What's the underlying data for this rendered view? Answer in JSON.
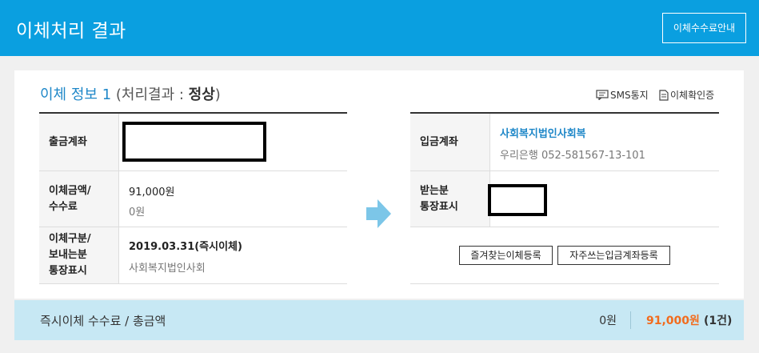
{
  "header": {
    "title": "이체처리 결과",
    "guide_button": "이체수수료안내"
  },
  "info": {
    "label": "이체 정보",
    "number": "1",
    "result_open": "(처리결과 : ",
    "result_status": "정상",
    "result_close": ")"
  },
  "tools": {
    "sms": "SMS통지",
    "confirm": "이체확인증"
  },
  "left_table": {
    "withdraw_label": "출금계좌",
    "amount_label_1": "이체금액/",
    "amount_label_2": "수수료",
    "amount_value": "91,000원",
    "fee_value": "0원",
    "type_label_1": "이체구분/",
    "type_label_2": "보내는분",
    "type_label_3": "통장표시",
    "type_value": "2019.03.31(즉시이체)",
    "sender_display": "사회복지법인사회"
  },
  "right_table": {
    "deposit_label": "입금계좌",
    "deposit_name": "사회복지법인사회복",
    "deposit_account": "우리은행 052-581567-13-101",
    "receiver_label_1": "받는분",
    "receiver_label_2": "통장표시",
    "favorite_button": "즐겨찾는이체등록",
    "frequent_button": "자주쓰는입금계좌등록"
  },
  "footer": {
    "label": "즉시이체 수수료 / 총금액",
    "fee": "0원",
    "total": "91,000원",
    "count": "(1건)"
  },
  "colors": {
    "header": "#0a9fe0",
    "accent": "#1e87c8",
    "total": "#f26b1d",
    "footer": "#c7e8f4"
  }
}
